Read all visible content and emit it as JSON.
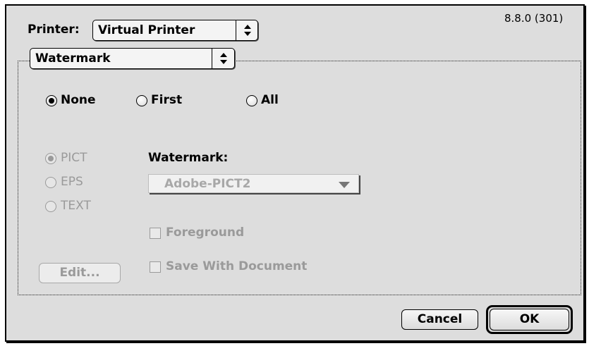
{
  "version": "8.8.0 (301)",
  "printer": {
    "label": "Printer:",
    "value": "Virtual Printer"
  },
  "panel_menu": {
    "value": "Watermark"
  },
  "pages": {
    "none": "None",
    "first": "First",
    "all": "All",
    "selected": "None"
  },
  "formats": {
    "pict": "PICT",
    "eps": "EPS",
    "text": "TEXT",
    "selected": "PICT"
  },
  "watermark": {
    "label": "Watermark:",
    "value": "Adobe-PICT2"
  },
  "options": {
    "foreground": "Foreground",
    "save_with_document": "Save With Document"
  },
  "buttons": {
    "edit": "Edit...",
    "cancel": "Cancel",
    "ok": "OK"
  },
  "icons": {
    "popup_arrows": "up-down-arrows-icon",
    "dropdown": "triangle-down-icon"
  }
}
